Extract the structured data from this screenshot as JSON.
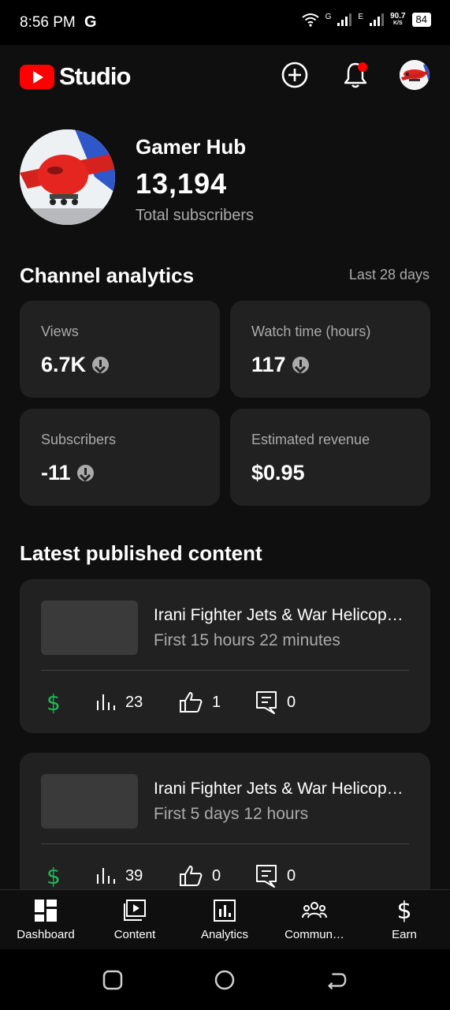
{
  "status": {
    "time": "8:56 PM",
    "carrier_icon": "G",
    "net_speed_value": "90.7",
    "net_speed_unit": "K/S",
    "battery": "84",
    "signal1_label": "G",
    "signal2_label": "E"
  },
  "app": {
    "logo_text": "Studio"
  },
  "channel": {
    "name": "Gamer Hub",
    "subscribers": "13,194",
    "subscribers_label": "Total subscribers"
  },
  "analytics": {
    "title": "Channel analytics",
    "period": "Last 28 days",
    "cards": [
      {
        "label": "Views",
        "value": "6.7K",
        "trend": "down"
      },
      {
        "label": "Watch time (hours)",
        "value": "117",
        "trend": "down"
      },
      {
        "label": "Subscribers",
        "value": "-11",
        "trend": "down"
      },
      {
        "label": "Estimated revenue",
        "value": "$0.95",
        "trend": ""
      }
    ]
  },
  "latest": {
    "title": "Latest published content",
    "videos": [
      {
        "title": "Irani Fighter Jets & War Helicop…",
        "age": "First 15 hours 22 minutes",
        "views": "23",
        "likes": "1",
        "comments": "0"
      },
      {
        "title": "Irani Fighter Jets & War Helicop…",
        "age": "First 5 days 12 hours",
        "views": "39",
        "likes": "0",
        "comments": "0"
      }
    ]
  },
  "nav": [
    {
      "label": "Dashboard",
      "icon": "dashboard-icon"
    },
    {
      "label": "Content",
      "icon": "content-icon"
    },
    {
      "label": "Analytics",
      "icon": "analytics-icon"
    },
    {
      "label": "Commun…",
      "icon": "community-icon"
    },
    {
      "label": "Earn",
      "icon": "earn-icon"
    }
  ],
  "colors": {
    "brand_red": "#ff0000",
    "monetized_green": "#1db954",
    "notification_dot": "#ff0000",
    "card_bg": "#212121",
    "page_bg": "#0f0f0f"
  }
}
